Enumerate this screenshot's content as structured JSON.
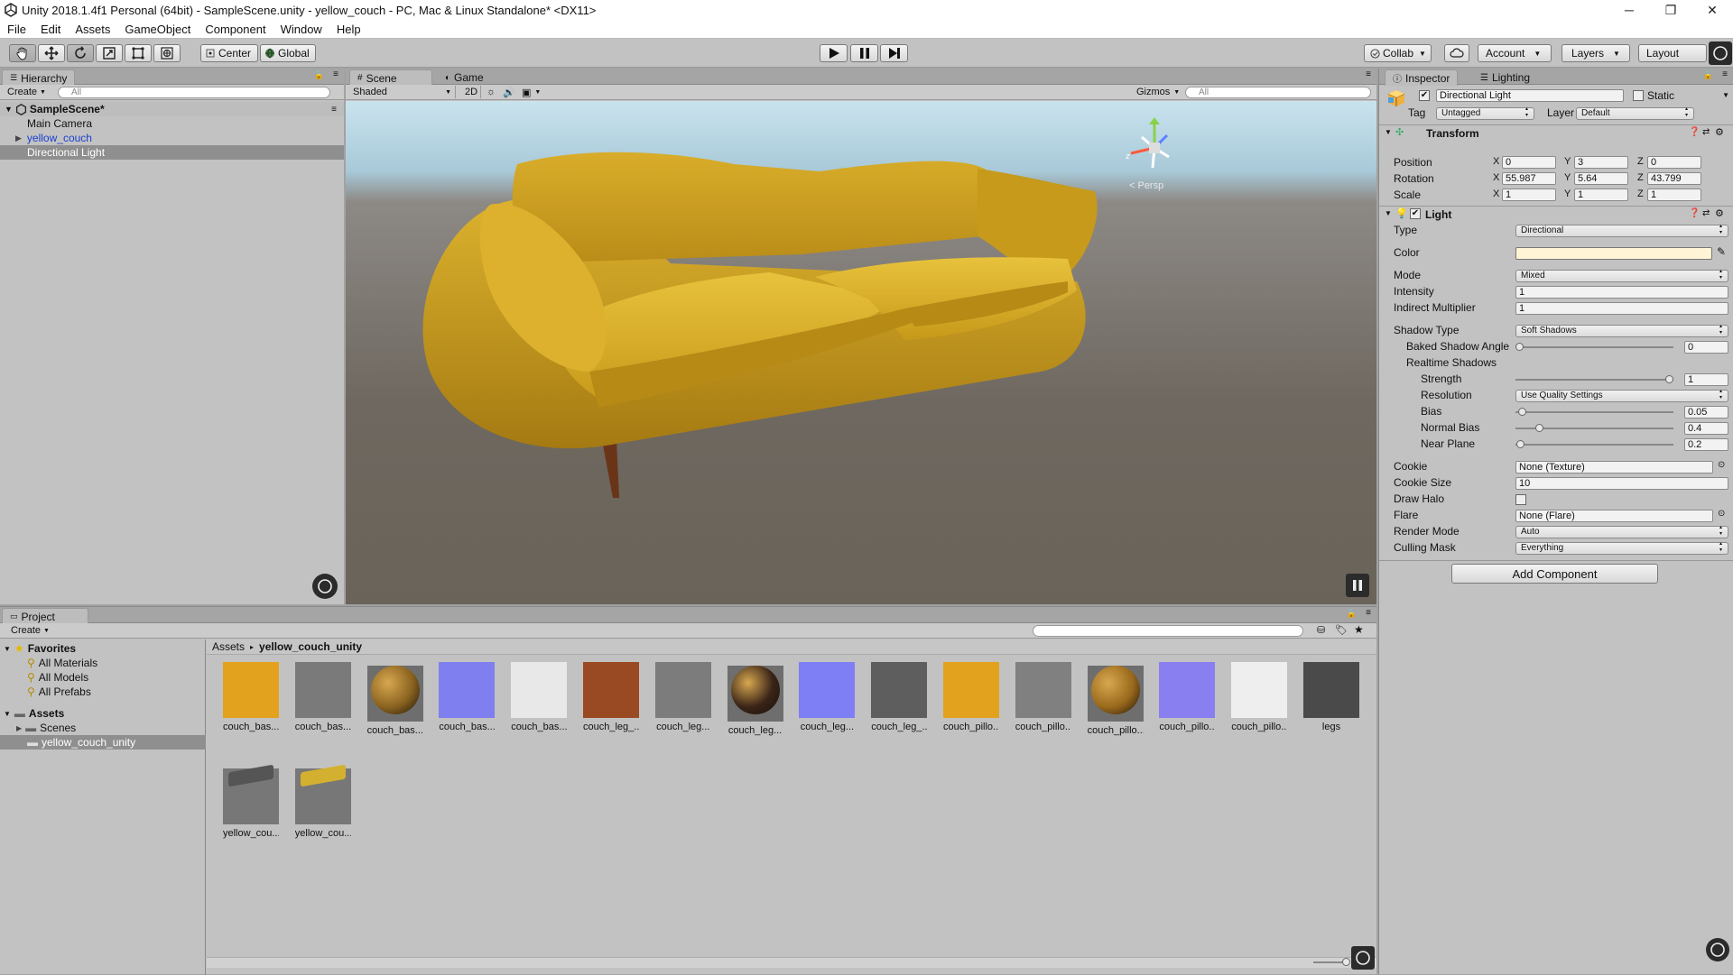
{
  "window": {
    "title": "Unity 2018.1.4f1 Personal (64bit) - SampleScene.unity - yellow_couch - PC, Mac & Linux Standalone* <DX11>",
    "minimize": "─",
    "restore": "❐",
    "close": "✕"
  },
  "menu": [
    "File",
    "Edit",
    "Assets",
    "GameObject",
    "Component",
    "Window",
    "Help"
  ],
  "toolbar": {
    "pivot": "Center",
    "space": "Global",
    "collab": "Collab",
    "account": "Account",
    "layers": "Layers",
    "layout": "Layout"
  },
  "hierarchy": {
    "tab": "Hierarchy",
    "create": "Create",
    "search_placeholder": "All",
    "scene": "SampleScene*",
    "items": [
      "Main Camera",
      "yellow_couch",
      "Directional Light"
    ]
  },
  "scene": {
    "tab_scene": "Scene",
    "tab_game": "Game",
    "shading": "Shaded",
    "mode_2d": "2D",
    "gizmos": "Gizmos",
    "search_placeholder": "All",
    "persp": "< Persp"
  },
  "inspector": {
    "tab": "Inspector",
    "tab_lighting": "Lighting",
    "object_name": "Directional Light",
    "static": "Static",
    "tag_label": "Tag",
    "tag": "Untagged",
    "layer_label": "Layer",
    "layer": "Default",
    "transform": {
      "title": "Transform",
      "position_label": "Position",
      "rotation_label": "Rotation",
      "scale_label": "Scale",
      "position": {
        "x": "0",
        "y": "3",
        "z": "0"
      },
      "rotation": {
        "x": "55.987",
        "y": "5.64",
        "z": "43.799"
      },
      "scale": {
        "x": "1",
        "y": "1",
        "z": "1"
      }
    },
    "light": {
      "title": "Light",
      "type_label": "Type",
      "type": "Directional",
      "color_label": "Color",
      "mode_label": "Mode",
      "mode": "Mixed",
      "intensity_label": "Intensity",
      "intensity": "1",
      "indirect_label": "Indirect Multiplier",
      "indirect": "1",
      "shadow_type_label": "Shadow Type",
      "shadow_type": "Soft Shadows",
      "baked_angle_label": "Baked Shadow Angle",
      "baked_angle": "0",
      "realtime_label": "Realtime Shadows",
      "strength_label": "Strength",
      "strength": "1",
      "resolution_label": "Resolution",
      "resolution": "Use Quality Settings",
      "bias_label": "Bias",
      "bias": "0.05",
      "normal_bias_label": "Normal Bias",
      "normal_bias": "0.4",
      "near_plane_label": "Near Plane",
      "near_plane": "0.2",
      "cookie_label": "Cookie",
      "cookie": "None (Texture)",
      "cookie_size_label": "Cookie Size",
      "cookie_size": "10",
      "draw_halo_label": "Draw Halo",
      "flare_label": "Flare",
      "flare": "None (Flare)",
      "render_mode_label": "Render Mode",
      "render_mode": "Auto",
      "culling_label": "Culling Mask",
      "culling": "Everything"
    },
    "add_component": "Add Component",
    "light_color": "#fff4d6"
  },
  "project": {
    "tab": "Project",
    "create": "Create",
    "favorites": "Favorites",
    "fav_items": [
      "All Materials",
      "All Models",
      "All Prefabs"
    ],
    "assets_root": "Assets",
    "folders": [
      "Scenes",
      "yellow_couch_unity"
    ],
    "breadcrumb_root": "Assets",
    "breadcrumb_current": "yellow_couch_unity",
    "assets": [
      {
        "name": "couch_bas...",
        "color": "#e3a21e"
      },
      {
        "name": "couch_bas...",
        "color": "#7a7a7a"
      },
      {
        "name": "couch_bas...",
        "color": "#8a6320"
      },
      {
        "name": "couch_bas...",
        "color": "#7f7ff0"
      },
      {
        "name": "couch_bas...",
        "color": "#e8e8e8"
      },
      {
        "name": "couch_leg_...",
        "color": "#9a4a22"
      },
      {
        "name": "couch_leg...",
        "color": "#7c7c7c"
      },
      {
        "name": "couch_leg...",
        "color": "#3a2418"
      },
      {
        "name": "couch_leg...",
        "color": "#7f7ff5"
      },
      {
        "name": "couch_leg_...",
        "color": "#5e5e5e"
      },
      {
        "name": "couch_pillo...",
        "color": "#e3a21e"
      },
      {
        "name": "couch_pillo...",
        "color": "#808080"
      },
      {
        "name": "couch_pillo...",
        "color": "#9a6a1c"
      },
      {
        "name": "couch_pillo...",
        "color": "#8a7ff0"
      },
      {
        "name": "couch_pillo...",
        "color": "#eeeeee"
      },
      {
        "name": "legs",
        "color": "#4a4a4a"
      },
      {
        "name": "yellow_cou...",
        "color": "#555555"
      },
      {
        "name": "yellow_cou...",
        "color": "#d4b030"
      }
    ]
  },
  "colors": {
    "accent_selection": "#8f8f8f",
    "link_blue": "#1a3fd0",
    "scene_bg": "#6d6760"
  }
}
